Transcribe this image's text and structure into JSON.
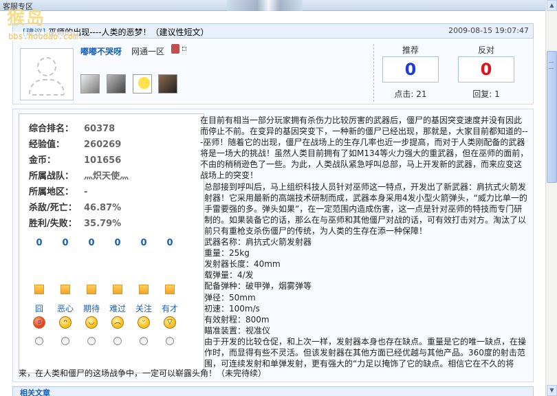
{
  "top": {
    "section_label": "客服专区"
  },
  "watermark": {
    "logo_text": "猴岛",
    "url_text": "bbs.houdao.com"
  },
  "post": {
    "tag": "[建议]",
    "title": "巫师的出现----人类的恶梦！（建议性短文）",
    "timestamp": "2009-08-15 19:07:47"
  },
  "user": {
    "name": "嘟嘟不哭呀",
    "zone": "网通一区",
    "avatar_icon": "default-avatar-icon"
  },
  "votes": {
    "recommend_label": "推荐",
    "recommend_count": "0",
    "oppose_label": "反对",
    "oppose_count": "0",
    "clicks": "点击: 21",
    "replies": "回复: 1"
  },
  "stats": [
    {
      "key": "综合排名：",
      "value": "60378"
    },
    {
      "key": "经验值：",
      "value": "260269"
    },
    {
      "key": "金币：",
      "value": "101656"
    },
    {
      "key": "所属战队：",
      "value": "灬炽天使灬"
    },
    {
      "key": "所属地区：",
      "value": "-"
    },
    {
      "key": "杀敌/死亡：",
      "value": "46.87%"
    },
    {
      "key": "胜利/失败：",
      "value": "35.79%"
    }
  ],
  "moods": [
    {
      "count": "0",
      "label": "囧",
      "face": "angry-face-icon"
    },
    {
      "count": "0",
      "label": "恶心",
      "face": "sick-face-icon"
    },
    {
      "count": "0",
      "label": "期待",
      "face": "smile-face-icon"
    },
    {
      "count": "0",
      "label": "难过",
      "face": "sad-face-icon"
    },
    {
      "count": "0",
      "label": "关注",
      "face": "wink-face-icon"
    },
    {
      "count": "0",
      "label": "有才",
      "face": "grin-face-icon"
    }
  ],
  "article": {
    "p1": "在目前有相当一部分玩家拥有杀伤力比较厉害的武器后，僵尸的基因突变速度并没有因此而停止不前。在变异的基因突变下，一种新的僵尸已经出现，那就是，大家目前都知道的---巫师！随着它的出现，僵尸在战场上的生存几率也近一步提高，而对于人类刚配备的武器将是一场大的挑战！虽然人类目前拥有了如M134等火力强大的重武器，但在巫师的面前，不由的稍稍逊色了一些。为此，人类战队紧急呼叫总部，马上开发新的武器，而来应变这战场上的突变！",
    "p2": "总部接到呼叫后，马上组织科技人员针对巫师这一特点，开发出了新武器：肩抗式火箭发射器！它采用最新的高端技术研制而成，武器本身采用4发小型火箭弹头，“威力比单一的手雷要强的多。弹头如果”，在一定范围内造成伤害，这一点是针对巫师的特技而专门研制的。如果装备它的话，那么在与巫师和其他僵尸对战的话，可有效打击对方。淘汰了以前只有重枪支杀伤僵尸的传统，为人类的生存在添一种保障！",
    "spec1": "武器名称：肩抗式火箭发射器",
    "spec2": "重量：25kg",
    "spec3": "发射器长度：40mm",
    "spec4": "载弹量：4/发",
    "spec5": "配备弹种：破甲弹，烟雾弹等",
    "spec6": "弹径：50mm",
    "spec7": "初速：100m/s",
    "spec8": "有效射程：800m",
    "spec9": "瞄准装置：视准仪",
    "p3": "由于开发的比较仓促，和上次一样，发射器本身也存在缺点。重量是它的唯一缺点，在操作时，而显得有些不灵活。但该发射器在其他方面已经优越与其他产品。360度的射击范围，可连续发射和单弹发射，更有强大的“力足以掩饰了它的缺点。相信它在不久的将",
    "tail": "来，在人类和僵尸的这场战争中，一定可以崭露头角！（未完待续）"
  },
  "bottom": {
    "label": "相关文章"
  }
}
